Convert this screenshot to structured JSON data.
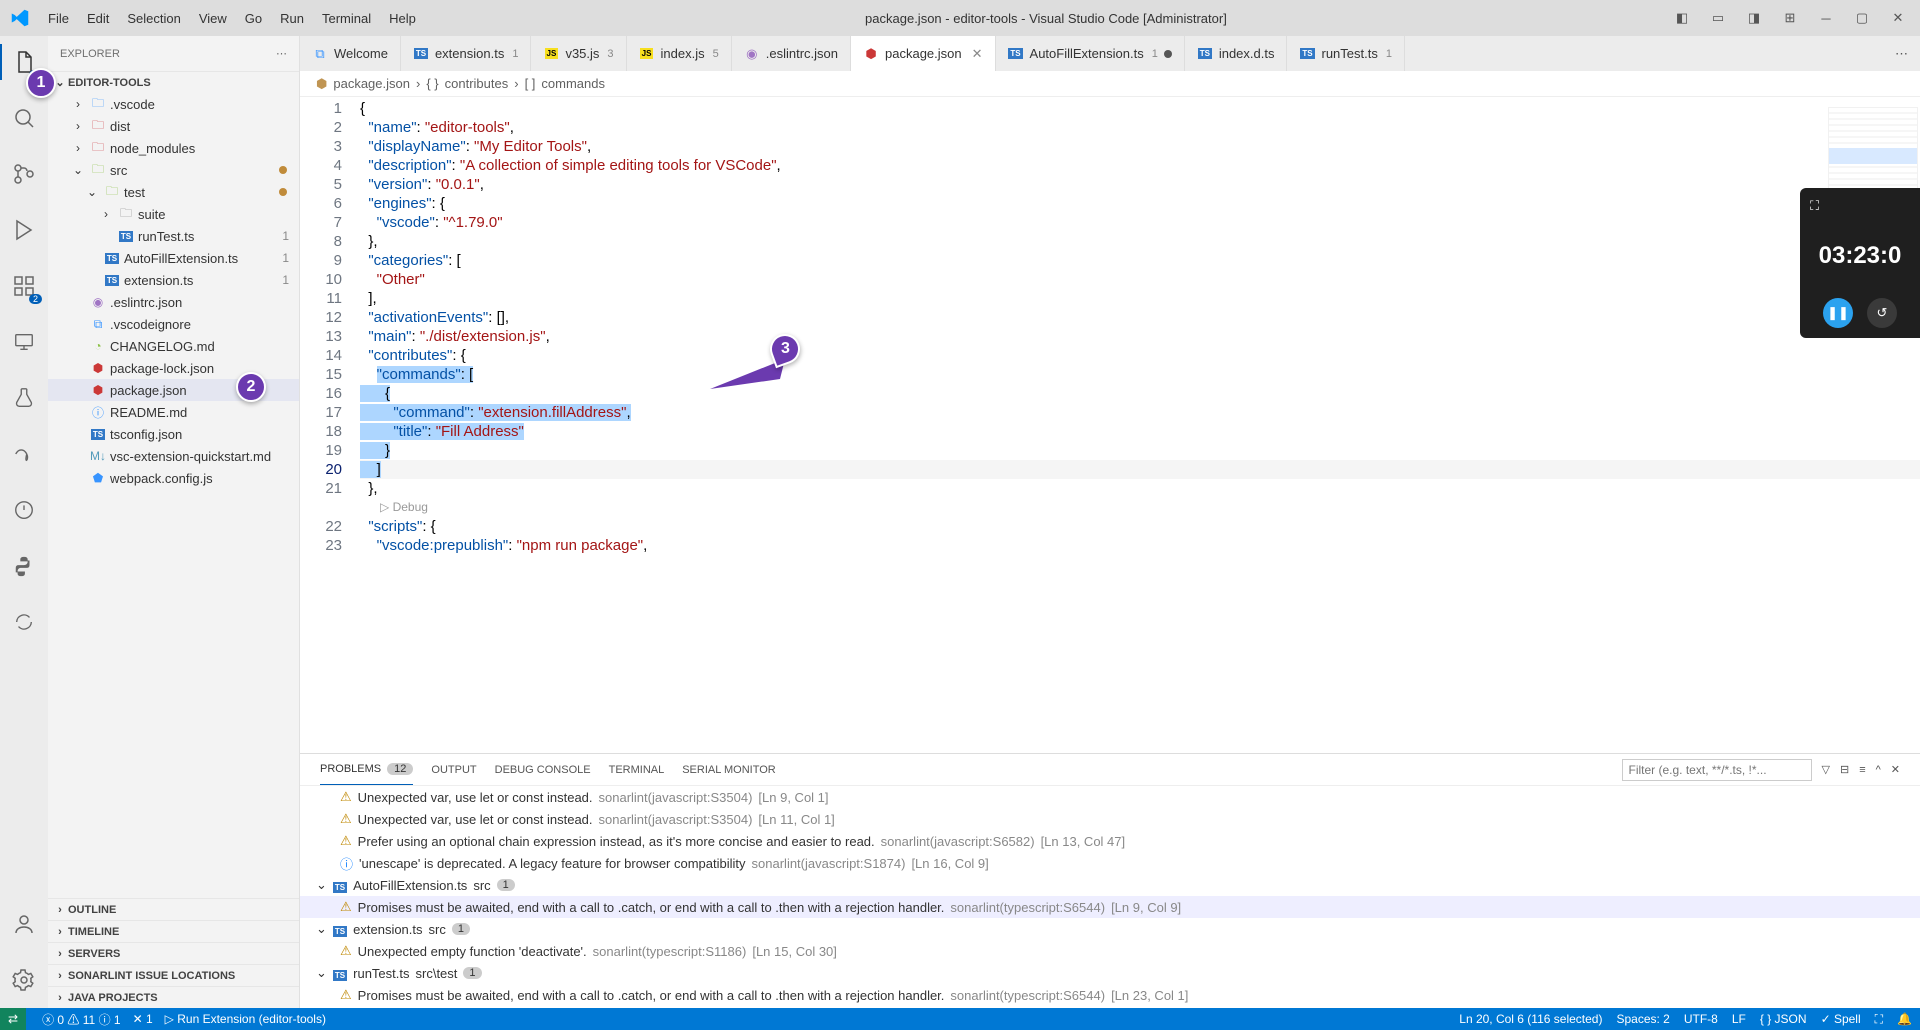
{
  "window": {
    "title": "package.json - editor-tools - Visual Studio Code [Administrator]"
  },
  "menu": [
    "File",
    "Edit",
    "Selection",
    "View",
    "Go",
    "Run",
    "Terminal",
    "Help"
  ],
  "activity": {
    "explorer_badge": "1",
    "scm_badge": "",
    "ext_badge": "2"
  },
  "sidebar": {
    "title": "EXPLORER",
    "root": "EDITOR-TOOLS",
    "tree": [
      {
        "depth": 1,
        "type": "folder",
        "icon": "folder-blue",
        "label": ".vscode",
        "chev": ">"
      },
      {
        "depth": 1,
        "type": "folder",
        "icon": "folder-red",
        "label": "dist",
        "chev": ">"
      },
      {
        "depth": 1,
        "type": "folder",
        "icon": "folder-red",
        "label": "node_modules",
        "chev": ">"
      },
      {
        "depth": 1,
        "type": "folder",
        "icon": "folder-green",
        "label": "src",
        "chev": "v",
        "modified": true
      },
      {
        "depth": 2,
        "type": "folder",
        "icon": "folder-green",
        "label": "test",
        "chev": "v",
        "modified": true
      },
      {
        "depth": 3,
        "type": "folder",
        "icon": "folder-grey",
        "label": "suite",
        "chev": ">"
      },
      {
        "depth": 3,
        "type": "file",
        "icon": "ts",
        "label": "runTest.ts",
        "badge": "1"
      },
      {
        "depth": 2,
        "type": "file",
        "icon": "ts",
        "label": "AutoFillExtension.ts",
        "badge": "1"
      },
      {
        "depth": 2,
        "type": "file",
        "icon": "ts",
        "label": "extension.ts",
        "badge": "1"
      },
      {
        "depth": 1,
        "type": "file",
        "icon": "eslint",
        "label": ".eslintrc.json"
      },
      {
        "depth": 1,
        "type": "file",
        "icon": "vscode",
        "label": ".vscodeignore"
      },
      {
        "depth": 1,
        "type": "file",
        "icon": "changelog",
        "label": "CHANGELOG.md"
      },
      {
        "depth": 1,
        "type": "file",
        "icon": "npm",
        "label": "package-lock.json"
      },
      {
        "depth": 1,
        "type": "file",
        "icon": "npm",
        "label": "package.json",
        "selected": true
      },
      {
        "depth": 1,
        "type": "file",
        "icon": "info",
        "label": "README.md"
      },
      {
        "depth": 1,
        "type": "file",
        "icon": "ts",
        "label": "tsconfig.json"
      },
      {
        "depth": 1,
        "type": "file",
        "icon": "md",
        "label": "vsc-extension-quickstart.md"
      },
      {
        "depth": 1,
        "type": "file",
        "icon": "webpack",
        "label": "webpack.config.js"
      }
    ],
    "sections": [
      "OUTLINE",
      "TIMELINE",
      "SERVERS",
      "SONARLINT ISSUE LOCATIONS",
      "JAVA PROJECTS"
    ]
  },
  "tabs": [
    {
      "icon": "vscode",
      "label": "Welcome"
    },
    {
      "icon": "ts",
      "label": "extension.ts",
      "badge": "1"
    },
    {
      "icon": "js",
      "label": "v35.js",
      "badge": "3"
    },
    {
      "icon": "js",
      "label": "index.js",
      "badge": "5"
    },
    {
      "icon": "eslint",
      "label": ".eslintrc.json"
    },
    {
      "icon": "npm",
      "label": "package.json",
      "active": true,
      "close": true
    },
    {
      "icon": "ts",
      "label": "AutoFillExtension.ts",
      "badge": "1",
      "dirty": true
    },
    {
      "icon": "ts",
      "label": "index.d.ts"
    },
    {
      "icon": "ts",
      "label": "runTest.ts",
      "badge": "1"
    }
  ],
  "breadcrumb": {
    "file": "package.json",
    "p1": "contributes",
    "p2": "commands"
  },
  "code": {
    "lines": [
      {
        "n": 1,
        "html": "<span class='tok-punc'>{</span>"
      },
      {
        "n": 2,
        "html": "  <span class='tok-key'>\"name\"</span><span class='tok-punc'>: </span><span class='tok-str'>\"editor-tools\"</span><span class='tok-punc'>,</span>"
      },
      {
        "n": 3,
        "html": "  <span class='tok-key'>\"displayName\"</span><span class='tok-punc'>: </span><span class='tok-str'>\"My Editor Tools\"</span><span class='tok-punc'>,</span>"
      },
      {
        "n": 4,
        "html": "  <span class='tok-key'>\"description\"</span><span class='tok-punc'>: </span><span class='tok-str'>\"A collection of simple editing tools for VSCode\"</span><span class='tok-punc'>,</span>"
      },
      {
        "n": 5,
        "html": "  <span class='tok-key'>\"version\"</span><span class='tok-punc'>: </span><span class='tok-str'>\"0.0.1\"</span><span class='tok-punc'>,</span>"
      },
      {
        "n": 6,
        "html": "  <span class='tok-key'>\"engines\"</span><span class='tok-punc'>: {</span>"
      },
      {
        "n": 7,
        "html": "    <span class='tok-key'>\"vscode\"</span><span class='tok-punc'>: </span><span class='tok-str'>\"^1.79.0\"</span>"
      },
      {
        "n": 8,
        "html": "  <span class='tok-punc'>},</span>"
      },
      {
        "n": 9,
        "html": "  <span class='tok-key'>\"categories\"</span><span class='tok-punc'>: [</span>"
      },
      {
        "n": 10,
        "html": "    <span class='tok-str'>\"Other\"</span>"
      },
      {
        "n": 11,
        "html": "  <span class='tok-punc'>],</span>"
      },
      {
        "n": 12,
        "html": "  <span class='tok-key'>\"activationEvents\"</span><span class='tok-punc'>: [],</span>"
      },
      {
        "n": 13,
        "html": "  <span class='tok-key'>\"main\"</span><span class='tok-punc'>: </span><span class='tok-str'>\"./dist/extension.js\"</span><span class='tok-punc'>,</span>"
      },
      {
        "n": 14,
        "html": "  <span class='tok-key'>\"contributes\"</span><span class='tok-punc'>: {</span>"
      },
      {
        "n": 15,
        "html": "    <span class='sel'><span class='tok-key'>\"commands\"</span><span class='tok-punc'>: [</span></span>",
        "selStart": true
      },
      {
        "n": 16,
        "html": "<span class='sel'>      <span class='tok-punc'>{</span></span>"
      },
      {
        "n": 17,
        "html": "<span class='sel'>        <span class='tok-key'>\"command\"</span><span class='tok-punc'>: </span><span class='tok-str'>\"extension.fillAddress\"</span><span class='tok-punc'>,</span></span>"
      },
      {
        "n": 18,
        "html": "<span class='sel'>        <span class='tok-key'>\"title\"</span><span class='tok-punc'>: </span><span class='tok-str'>\"Fill Address\"</span></span>"
      },
      {
        "n": 19,
        "html": "<span class='sel'>      <span class='tok-punc'>}</span></span>"
      },
      {
        "n": 20,
        "html": "<span class='sel'>    <span class='tok-punc'>]</span></span>",
        "current": true
      },
      {
        "n": 21,
        "html": "  <span class='tok-punc'>},</span>"
      },
      {
        "n": "",
        "html": "",
        "codelens": "Debug"
      },
      {
        "n": 22,
        "html": "  <span class='tok-key'>\"scripts\"</span><span class='tok-punc'>: {</span>"
      },
      {
        "n": 23,
        "html": "    <span class='tok-key'>\"vscode:prepublish\"</span><span class='tok-punc'>: </span><span class='tok-str'>\"npm run package\"</span><span class='tok-punc'>,</span>"
      }
    ]
  },
  "panel": {
    "tabs": [
      {
        "label": "PROBLEMS",
        "badge": "12",
        "active": true
      },
      {
        "label": "OUTPUT"
      },
      {
        "label": "DEBUG CONSOLE"
      },
      {
        "label": "TERMINAL"
      },
      {
        "label": "SERIAL MONITOR"
      }
    ],
    "filter_placeholder": "Filter (e.g. text, **/*.ts, !*...",
    "items": [
      {
        "type": "row",
        "sev": "warn",
        "msg": "Unexpected var, use let or const instead.",
        "lint": "sonarlint(javascript:S3504)",
        "loc": "[Ln 9, Col 1]"
      },
      {
        "type": "row",
        "sev": "warn",
        "msg": "Unexpected var, use let or const instead.",
        "lint": "sonarlint(javascript:S3504)",
        "loc": "[Ln 11, Col 1]"
      },
      {
        "type": "row",
        "sev": "warn",
        "msg": "Prefer using an optional chain expression instead, as it's more concise and easier to read.",
        "lint": "sonarlint(javascript:S6582)",
        "loc": "[Ln 13, Col 47]"
      },
      {
        "type": "row",
        "sev": "info",
        "msg": "'unescape' is deprecated. A legacy feature for browser compatibility",
        "lint": "sonarlint(javascript:S1874)",
        "loc": "[Ln 16, Col 9]"
      },
      {
        "type": "group",
        "icon": "ts",
        "label": "AutoFillExtension.ts",
        "path": "src",
        "count": "1"
      },
      {
        "type": "row",
        "sev": "warn",
        "msg": "Promises must be awaited, end with a call to .catch, or end with a call to .then with a rejection handler.",
        "lint": "sonarlint(typescript:S6544)",
        "loc": "[Ln 9, Col 9]",
        "hl": true
      },
      {
        "type": "group",
        "icon": "ts",
        "label": "extension.ts",
        "path": "src",
        "count": "1"
      },
      {
        "type": "row",
        "sev": "warn",
        "msg": "Unexpected empty function 'deactivate'.",
        "lint": "sonarlint(typescript:S1186)",
        "loc": "[Ln 15, Col 30]"
      },
      {
        "type": "group",
        "icon": "ts",
        "label": "runTest.ts",
        "path": "src\\test",
        "count": "1"
      },
      {
        "type": "row",
        "sev": "warn",
        "msg": "Promises must be awaited, end with a call to .catch, or end with a call to .then with a rejection handler.",
        "lint": "sonarlint(typescript:S6544)",
        "loc": "[Ln 23, Col 1]"
      }
    ]
  },
  "status": {
    "errors": "0",
    "warns": "11",
    "infos": "1",
    "ports": "1",
    "launch": "Run Extension (editor-tools)",
    "sel": "Ln 20, Col 6 (116 selected)",
    "spaces": "Spaces: 2",
    "enc": "UTF-8",
    "eol": "LF",
    "lang": "JSON",
    "spell": "Spell"
  },
  "recorder": {
    "time": "03:23:0"
  },
  "annotations": {
    "n1": "1",
    "n2": "2",
    "n3": "3"
  }
}
